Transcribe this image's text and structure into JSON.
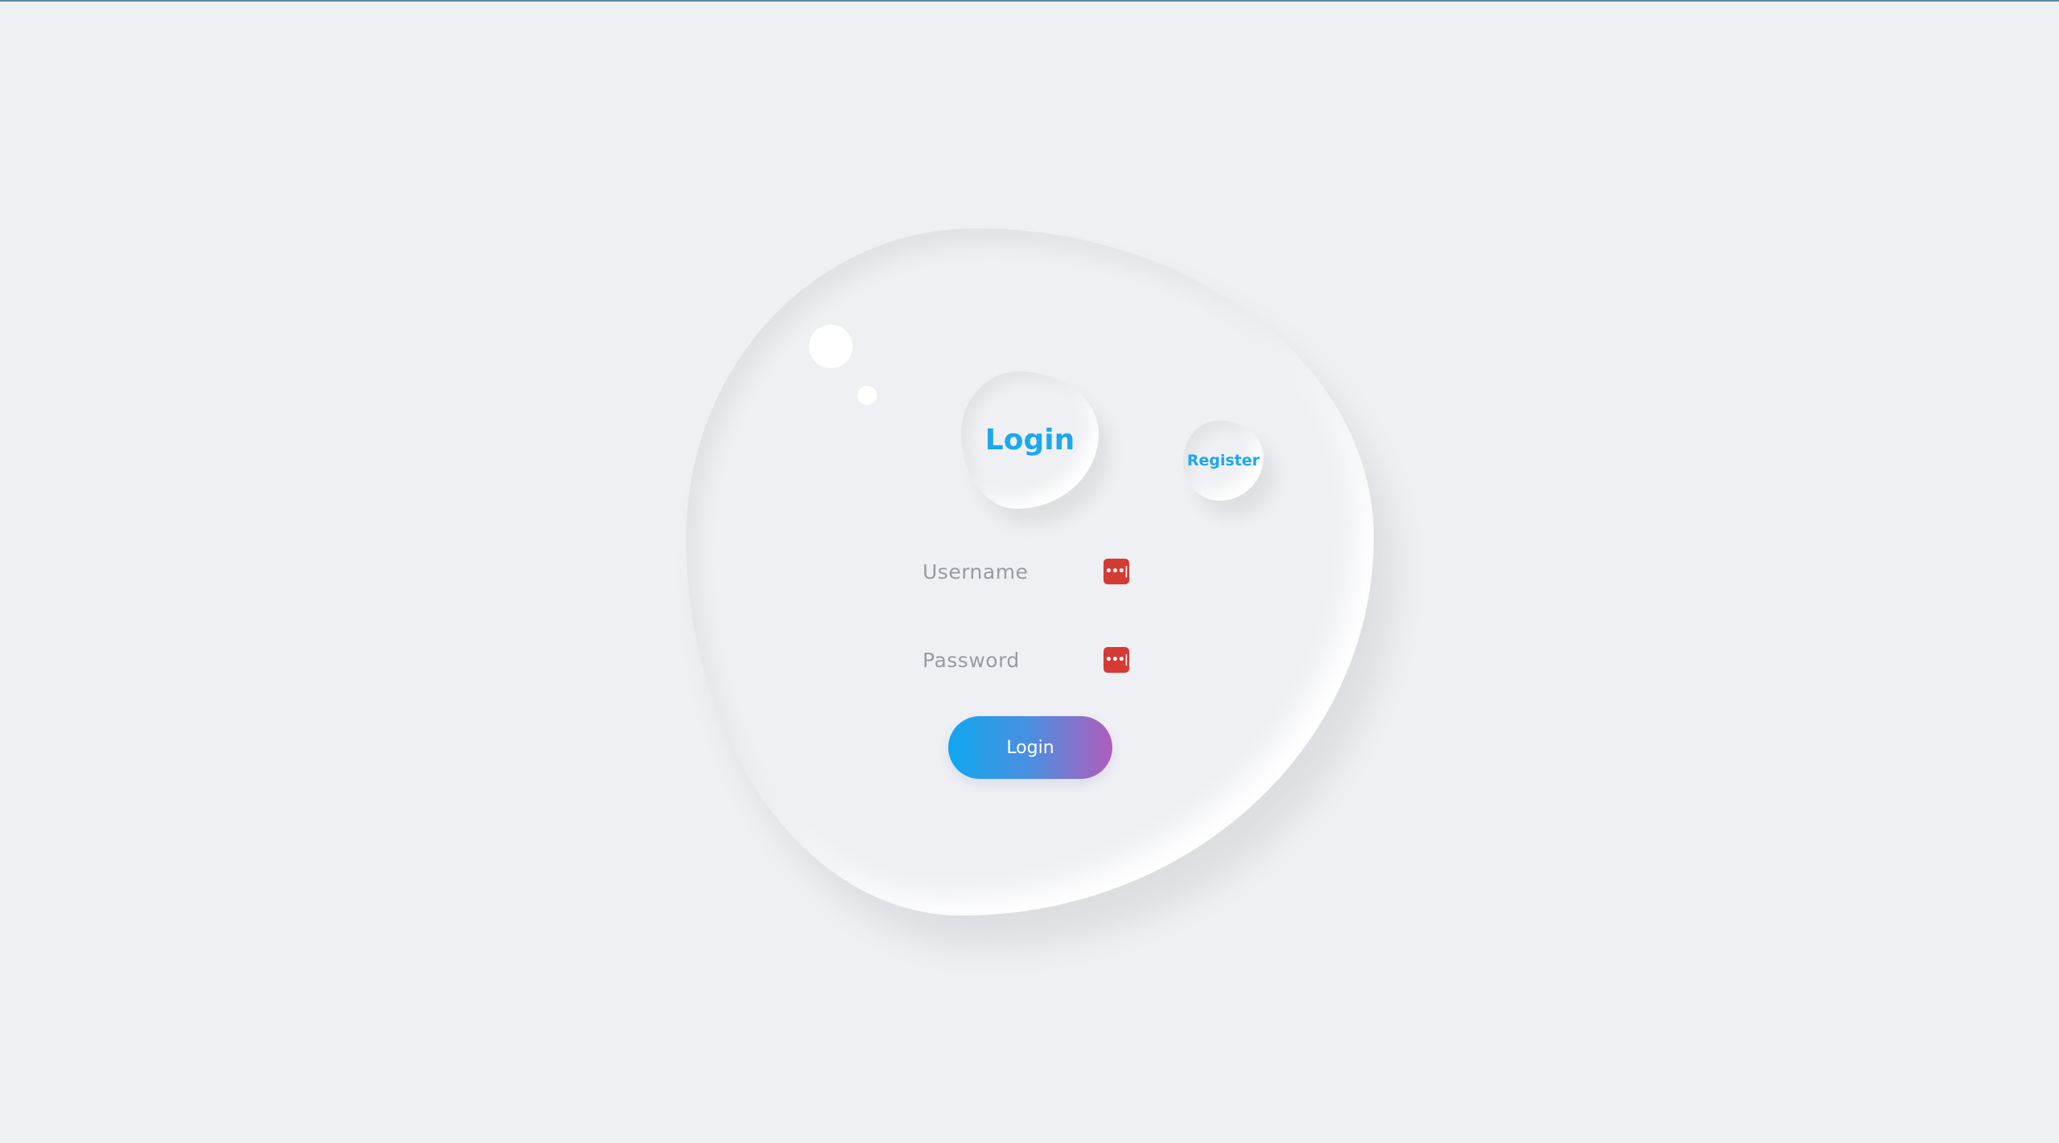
{
  "auth": {
    "tab_login": "Login",
    "tab_register": "Register",
    "username_placeholder": "Username",
    "password_placeholder": "Password",
    "submit_label": "Login",
    "username_value": "",
    "password_value": ""
  },
  "icons": {
    "field_icon": "password-manager-key-icon",
    "field_icon_glyph": "•••|"
  },
  "colors": {
    "accent": "#1ba8ec",
    "background": "#eff0f4",
    "button_gradient_start": "#0fa7ee",
    "button_gradient_end": "#b15cbc",
    "key_icon": "#d43b34"
  }
}
